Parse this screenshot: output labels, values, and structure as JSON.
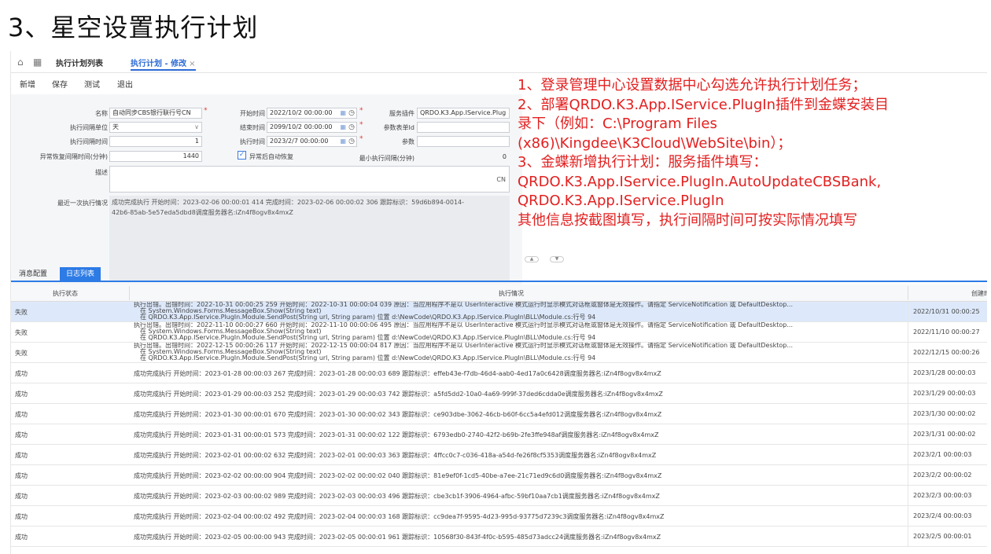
{
  "slide_title": "3、星空设置执行计划",
  "tabbar": {
    "tabs": [
      {
        "label": "执行计划列表"
      },
      {
        "label": "执行计划 - 修改",
        "close": "×"
      }
    ]
  },
  "toolbar": {
    "new_label": "新增",
    "save_label": "保存",
    "test_label": "测试",
    "exit_label": "退出"
  },
  "form": {
    "name_label": "名称",
    "name_value": "自动同步CBS银行联行号CN",
    "interval_unit_label": "执行间隔单位",
    "interval_unit_value": "天",
    "interval_time_label": "执行间隔时间",
    "interval_time_value": "1",
    "exception_interval_label": "异常恢复间隔时间(分钟)",
    "exception_interval_value": "1440",
    "start_time_label": "开始时间",
    "start_time_value": "2022/10/2 00:00:00",
    "end_time_label": "结束时间",
    "end_time_value": "2099/10/2 00:00:00",
    "exec_time_label": "执行时间",
    "exec_time_value": "2023/2/7 00:00:00",
    "auto_recover_label": "异常后自动恢复",
    "auto_recover_checked": "✓",
    "service_plugin_label": "服务插件",
    "service_plugin_value": "QRDO.K3.App.IService.Plug",
    "param_form_label": "参数表单Id",
    "param_label": "参数",
    "min_interval_label": "最小执行间隔(分钟)",
    "min_interval_value": "0",
    "desc_label": "描述",
    "desc_lang": "CN",
    "last_exec_label": "最近一次执行情况",
    "last_exec_line1": "成功完成执行  开始时间：2023-02-06 00:00:01 414  完成时间：2023-02-06 00:00:02 306  跟踪标识：59d6b894-0014-",
    "last_exec_line2": "42b6-85ab-5e57eda5dbd8调度服务器名:iZn4f8ogv8x4mxZ"
  },
  "annotation": {
    "lines": [
      "1、登录管理中心设置数据中心勾选允许执行计划任务；",
      "2、部署QRDO.K3.App.IService.PlugIn插件到金蝶安装目",
      "录下（例如：C:\\Program Files",
      "(x86)\\Kingdee\\K3Cloud\\WebSite\\bin）；",
      "3、金蝶新增执行计划：服务插件填写：",
      "QRDO.K3.App.IService.PlugIn.AutoUpdateCBSBank,",
      "QRDO.K3.App.IService.PlugIn",
      "其他信息按截图填写，执行间隔时间可按实际情况填写"
    ],
    "color": "#e32020"
  },
  "bottom_tabs": {
    "msg_config": "消息配置",
    "log_list": "日志列表"
  },
  "grid": {
    "headers": {
      "status": "执行状态",
      "detail": "执行情况",
      "created": "创建时"
    },
    "fail_rows": [
      {
        "status": "失败",
        "line1": "执行出错。出错时间：2022-10-31 00:00:25 259  开始时间：2022-10-31 00:00:04 039  原因：当应用程序不是以 UserInteractive 模式运行时显示模式对话框或窗体是无效操作。请指定 ServiceNotification 或 DefaultDesktop...",
        "line2": "在 System.Windows.Forms.MessageBox.Show(String text)",
        "line3": "在 QRDO.K3.App.IService.PlugIn.Module.SendPost(String url, String param) 位置 d:\\NewCode\\QRDO.K3.App.IService.PlugIn\\BLL\\Module.cs:行号 94",
        "created": "2022/10/31 00:00:25"
      },
      {
        "status": "失败",
        "line1": "执行出错。出错时间：2022-11-10 00:00:27 660  开始时间：2022-11-10 00:00:06 495  原因：当应用程序不是以 UserInteractive 模式运行时显示模式对话框或窗体是无效操作。请指定 ServiceNotification 或 DefaultDesktop...",
        "line2": "在 System.Windows.Forms.MessageBox.Show(String text)",
        "line3": "在 QRDO.K3.App.IService.PlugIn.Module.SendPost(String url, String param) 位置 d:\\NewCode\\QRDO.K3.App.IService.PlugIn\\BLL\\Module.cs:行号 94",
        "created": "2022/11/10 00:00:27"
      },
      {
        "status": "失败",
        "line1": "执行出错。出错时间：2022-12-15 00:00:26 117  开始时间：2022-12-15 00:00:04 817  原因：当应用程序不是以 UserInteractive 模式运行时显示模式对话框或窗体是无效操作。请指定 ServiceNotification 或 DefaultDesktop...",
        "line2": "在 System.Windows.Forms.MessageBox.Show(String text)",
        "line3": "在 QRDO.K3.App.IService.PlugIn.Module.SendPost(String url, String param) 位置 d:\\NewCode\\QRDO.K3.App.IService.PlugIn\\BLL\\Module.cs:行号 94",
        "created": "2022/12/15 00:00:26"
      }
    ],
    "ok_rows": [
      {
        "status": "成功",
        "detail": "成功完成执行  开始时间：2023-01-28 00:00:03 267  完成时间：2023-01-28 00:00:03 689  跟踪标识：effeb43e-f7db-46d4-aab0-4ed17a0c6428调度服务器名:iZn4f8ogv8x4mxZ",
        "created": "2023/1/28 00:00:03"
      },
      {
        "status": "成功",
        "detail": "成功完成执行  开始时间：2023-01-29 00:00:03 252  完成时间：2023-01-29 00:00:03 742  跟踪标识：a5fd5dd2-10a0-4a69-999f-37ded6cdda0e调度服务器名:iZn4f8ogv8x4mxZ",
        "created": "2023/1/29 00:00:03"
      },
      {
        "status": "成功",
        "detail": "成功完成执行  开始时间：2023-01-30 00:00:01 670  完成时间：2023-01-30 00:00:02 343  跟踪标识：ce903dbe-3062-46cb-b60f-6cc5a4efd012调度服务器名:iZn4f8ogv8x4mxZ",
        "created": "2023/1/30 00:00:02"
      },
      {
        "status": "成功",
        "detail": "成功完成执行  开始时间：2023-01-31 00:00:01 573  完成时间：2023-01-31 00:00:02 122  跟踪标识：6793edb0-2740-42f2-b69b-2fe3ffe948af调度服务器名:iZn4f8ogv8x4mxZ",
        "created": "2023/1/31 00:00:02"
      },
      {
        "status": "成功",
        "detail": "成功完成执行  开始时间：2023-02-01 00:00:02 632  完成时间：2023-02-01 00:00:03 363  跟踪标识：4ffcc0c7-c036-418a-a54d-fe26f8cf5353调度服务器名:iZn4f8ogv8x4mxZ",
        "created": "2023/2/1 00:00:03"
      },
      {
        "status": "成功",
        "detail": "成功完成执行  开始时间：2023-02-02 00:00:00 904  完成时间：2023-02-02 00:00:02 040  跟踪标识：81e9ef0f-1cd5-40be-a7ee-21c71ed9c6d0调度服务器名:iZn4f8ogv8x4mxZ",
        "created": "2023/2/2 00:00:02"
      },
      {
        "status": "成功",
        "detail": "成功完成执行  开始时间：2023-02-03 00:00:02 989  完成时间：2023-02-03 00:00:03 496  跟踪标识：cbe3cb1f-3906-4964-afbc-59bf10aa7cb1调度服务器名:iZn4f8ogv8x4mxZ",
        "created": "2023/2/3 00:00:03"
      },
      {
        "status": "成功",
        "detail": "成功完成执行  开始时间：2023-02-04 00:00:02 492  完成时间：2023-02-04 00:00:03 168  跟踪标识：cc9dea7f-9595-4d23-995d-93775d7239c3调度服务器名:iZn4f8ogv8x4mxZ",
        "created": "2023/2/4 00:00:03"
      },
      {
        "status": "成功",
        "detail": "成功完成执行  开始时间：2023-02-05 00:00:00 943  完成时间：2023-02-05 00:00:01 961  跟踪标识：10568f30-843f-4f0c-b595-485d73adcc24调度服务器名:iZn4f8ogv8x4mxZ",
        "created": "2023/2/5 00:00:01"
      }
    ]
  }
}
